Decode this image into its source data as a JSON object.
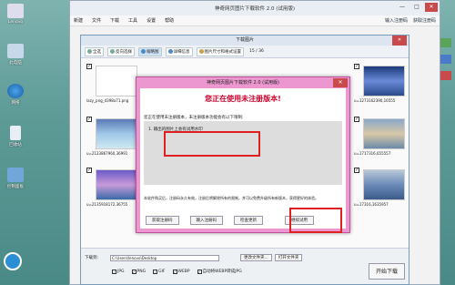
{
  "desktop": {
    "icons": [
      {
        "label": "Lenovo"
      },
      {
        "label": "此电脑"
      },
      {
        "label": "网络"
      },
      {
        "label": "回收站"
      },
      {
        "label": "控制面板"
      }
    ]
  },
  "main_window": {
    "title": "神奇网页图片下载软件 2.0 (试用版)",
    "menu": [
      "新建",
      "文件",
      "下载",
      "工具",
      "设置",
      "帮助"
    ],
    "right_links": [
      "输入注册码",
      "获取注册码"
    ],
    "ctrl_min": "—",
    "ctrl_max": "□",
    "ctrl_close": "✕"
  },
  "list_window": {
    "title": "下载图片",
    "close": "✕",
    "toolbar": {
      "select_all": "全选",
      "invert": "反向选择",
      "thumb_view": "缩略图",
      "detail_view": "详细信息",
      "filter": "图片尺寸和格式设置",
      "count": "15 / 36"
    },
    "files": [
      "lazy_png_d398a71.png",
      "u=2123867960,36991",
      "u=2135918172,36755",
      "u=1273162390,16555",
      "u=1717316,655557",
      "u=17316,1635957"
    ],
    "bottom": {
      "download_to_label": "下载到:",
      "path": "C:\\Users\\lenovo\\Desktop",
      "change_btn": "更改文件夹...",
      "open_btn": "打开文件夹",
      "formats": [
        "JPG",
        "PNG",
        "GIF",
        "WEBP",
        "自动将WEBP转成JPG"
      ],
      "start": "开始下载"
    }
  },
  "modal": {
    "title": "神奇网页图片下载软件 2.0 (试用版)",
    "close": "✕",
    "heading": "您正在使用未注册版本!",
    "intro": "您正在使用未注册版本，未注册版本功能会有以下限制:",
    "feature": "1. 输出的图片上会有试用水印",
    "footer": "本软件购买后，注册码永久有效，注册后将解除所有的限制，并可以免费升级所有新版本，获得更好的体验。",
    "buttons": [
      "获取注册码",
      "输入注册码",
      "检查更新",
      "继续试用"
    ]
  }
}
